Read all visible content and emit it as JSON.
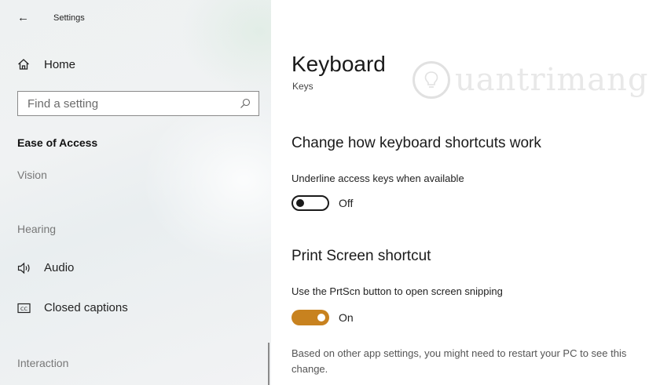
{
  "window": {
    "title": "Settings"
  },
  "colors": {
    "accent": "#c8821f",
    "sidebar_bg": "#eef1f2"
  },
  "sidebar": {
    "home_label": "Home",
    "search_placeholder": "Find a setting",
    "section_title": "Ease of Access",
    "groups": {
      "vision": "Vision",
      "hearing": "Hearing",
      "interaction": "Interaction"
    },
    "items": [
      {
        "label": "Audio",
        "icon": "speaker-icon"
      },
      {
        "label": "Closed captions",
        "icon": "closed-captions-icon"
      }
    ]
  },
  "main": {
    "title": "Keyboard",
    "subtitle": "Keys",
    "watermark": "uantrimang",
    "sections": [
      {
        "heading": "Change how keyboard shortcuts work",
        "setting_label": "Underline access keys when available",
        "toggle_state": "Off"
      },
      {
        "heading": "Print Screen shortcut",
        "setting_label": "Use the PrtScn button to open screen snipping",
        "toggle_state": "On"
      }
    ],
    "note": "Based on other app settings, you might need to restart your PC to see this change."
  }
}
